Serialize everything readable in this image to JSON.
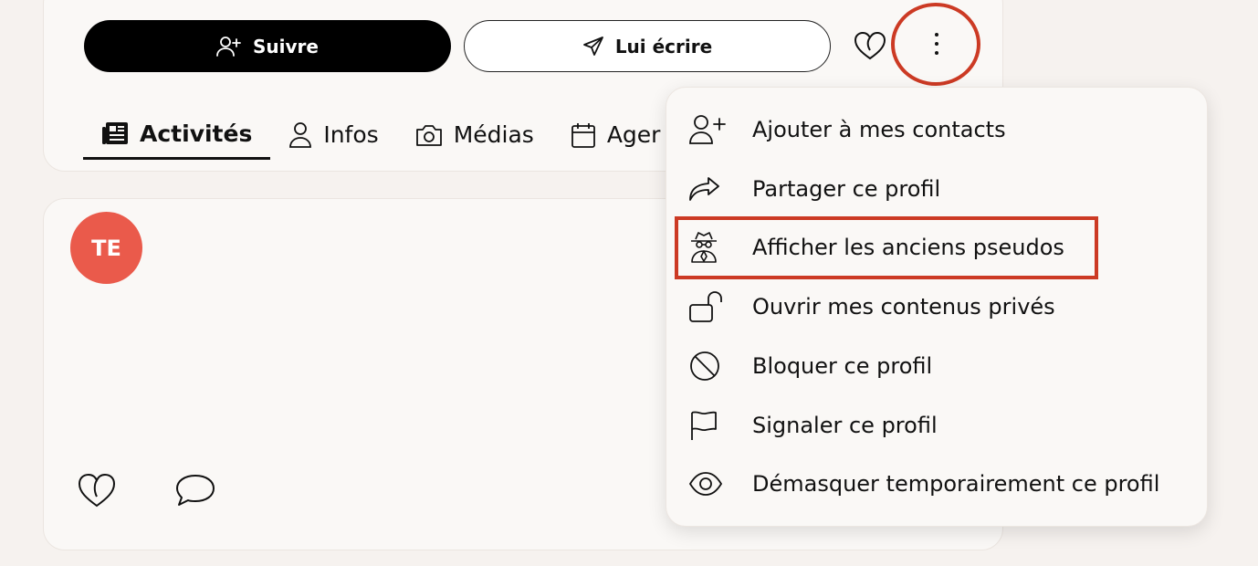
{
  "profile": {
    "follow_label": "Suivre",
    "write_label": "Lui écrire"
  },
  "tabs": [
    {
      "label": "Activités",
      "icon": "newspaper-icon",
      "active": true
    },
    {
      "label": "Infos",
      "icon": "user-icon"
    },
    {
      "label": "Médias",
      "icon": "camera-icon"
    },
    {
      "label": "Ager",
      "icon": "calendar-icon"
    }
  ],
  "post": {
    "avatar_initials": "TE",
    "avatar_color": "#ea5a4b"
  },
  "menu": {
    "items": [
      {
        "label": "Ajouter à mes contacts",
        "icon": "add-user-icon"
      },
      {
        "label": "Partager ce profil",
        "icon": "share-icon"
      },
      {
        "label": "Afficher les anciens pseudos",
        "icon": "spy-icon"
      },
      {
        "label": "Ouvrir mes contenus privés",
        "icon": "unlock-icon"
      },
      {
        "label": "Bloquer ce profil",
        "icon": "block-icon"
      },
      {
        "label": "Signaler ce profil",
        "icon": "flag-icon"
      },
      {
        "label": "Démasquer temporairement ce profil",
        "icon": "eye-icon"
      }
    ]
  },
  "colors": {
    "highlight": "#cc3a24",
    "background": "#f6f2ef",
    "card": "#faf8f6"
  }
}
